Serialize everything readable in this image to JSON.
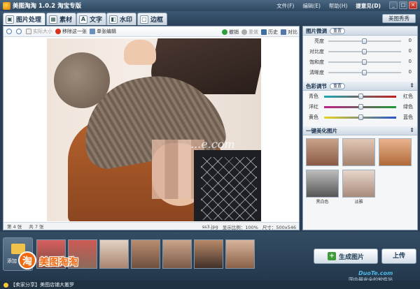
{
  "window": {
    "title": "美图淘淘 1.0.2 淘宝专版",
    "menu": [
      "文件(F)",
      "编辑(E)",
      "帮助(H)"
    ],
    "feedback": "提意见(D)",
    "controls": [
      "_",
      "□",
      "×"
    ]
  },
  "tabs": [
    {
      "label": "图片处理",
      "icon": "▣"
    },
    {
      "label": "素材",
      "icon": "▦"
    },
    {
      "label": "文字",
      "icon": "A"
    },
    {
      "label": "水印",
      "icon": "◧"
    },
    {
      "label": "边框",
      "icon": "▢"
    }
  ],
  "beautify_button": "美图秀秀",
  "toolbar": {
    "actual_size": "实际大小",
    "remove": "移除这一张",
    "single_edit": "单张编辑",
    "undo": "撤销",
    "redo": "重做",
    "history": "历史",
    "compare": "对比"
  },
  "canvas": {
    "watermark": "...e.com"
  },
  "status": {
    "page": "第 4 张",
    "total": "共 7 张",
    "filename": "ss3.jpg",
    "ratio": "显示比例：100%",
    "size": "尺寸：500x546"
  },
  "panel": {
    "adjust_title": "图片微调",
    "reset": "重置",
    "sliders": [
      {
        "label": "亮度",
        "value": "0"
      },
      {
        "label": "对比度",
        "value": "0"
      },
      {
        "label": "饱和度",
        "value": "0"
      },
      {
        "label": "清晰度",
        "value": "0"
      }
    ],
    "color_title": "色彩调节",
    "color_rows": [
      {
        "left": "青色",
        "right": "红色",
        "gradient": "linear-gradient(90deg,#1aa8b0,#c31d1d)"
      },
      {
        "left": "洋红",
        "right": "绿色",
        "gradient": "linear-gradient(90deg,#c21e8b,#1e9b33)"
      },
      {
        "left": "黄色",
        "right": "蓝色",
        "gradient": "linear-gradient(90deg,#e8d31c,#2555c8)"
      }
    ],
    "presets_title": "一键美化图片",
    "presets": [
      {
        "label": ""
      },
      {
        "label": ""
      },
      {
        "label": ""
      },
      {
        "label": "黑白色"
      },
      {
        "label": "淡雅"
      }
    ]
  },
  "filmstrip": {
    "add_label": "添加",
    "logo_icon": "淘",
    "logo_text": "美图淘淘",
    "count": 7,
    "generate": "生成图片",
    "upload": "上传",
    "site": "DuoTe.com",
    "site_sub": "国内最安全的软件站"
  },
  "bottom": {
    "text": "【卖家分享】美图店铺大搬罗"
  }
}
